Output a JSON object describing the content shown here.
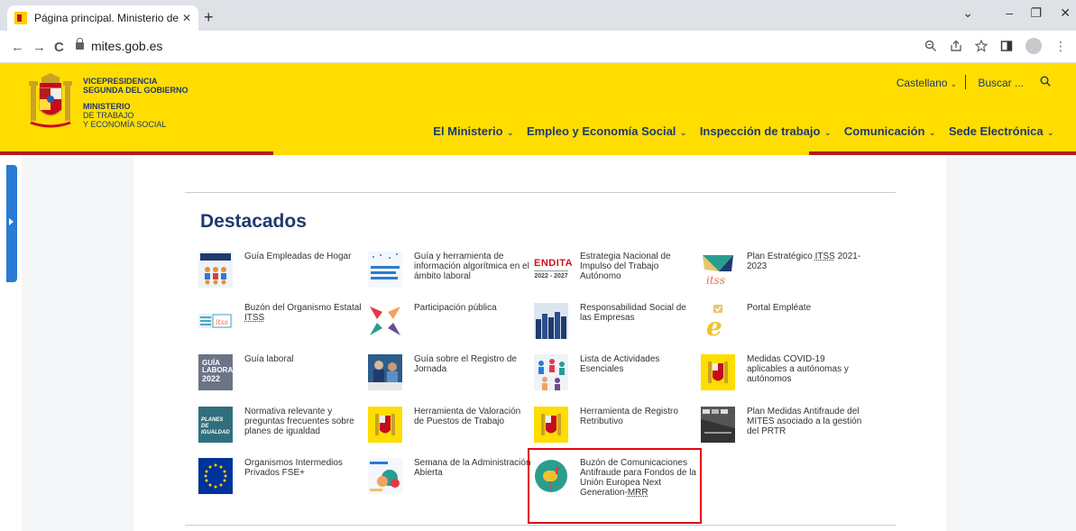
{
  "browser": {
    "tab_title": "Página principal. Ministerio de Tr",
    "tab_close": "✕",
    "new_tab": "+",
    "url": "mites.gob.es",
    "back": "←",
    "forward": "→",
    "reload": "C",
    "minimize": "–",
    "restore": "❐",
    "close": "✕",
    "chevron": "⌄"
  },
  "header": {
    "brand_line1": "VICEPRESIDENCIA",
    "brand_line2": "SEGUNDA DEL GOBIERNO",
    "brand_line3": "MINISTERIO",
    "brand_line4": "DE TRABAJO",
    "brand_line5": "Y ECONOMÍA SOCIAL",
    "language": "Castellano",
    "search": "Buscar ...",
    "nav": [
      {
        "label": "El Ministerio"
      },
      {
        "label": "Empleo y Economía Social"
      },
      {
        "label": "Inspección de trabajo"
      },
      {
        "label": "Comunicación"
      },
      {
        "label": "Sede Electrónica"
      }
    ]
  },
  "main": {
    "heading": "Destacados",
    "items": [
      {
        "label": "Guía Empleadas de Hogar"
      },
      {
        "label": "Guía y herramienta de información algorítmica en el ámbito laboral"
      },
      {
        "label": "Estrategia Nacional de Impulso del Trabajo Autónomo"
      },
      {
        "label_a": "Plan Estratégico ",
        "abbr": "ITSS",
        "label_b": " 2021-2023"
      },
      {
        "label_a": "Buzón del Organismo Estatal ",
        "abbr": "ITSS",
        "label_b": ""
      },
      {
        "label": "Participación pública"
      },
      {
        "label": "Responsabilidad Social de las Empresas"
      },
      {
        "label": "Portal Empléate"
      },
      {
        "label": "Guía laboral"
      },
      {
        "label": "Guía sobre el Registro de Jornada"
      },
      {
        "label": "Lista de Actividades Esenciales"
      },
      {
        "label": "Medidas COVID-19 aplicables a autónomas y autónomos"
      },
      {
        "label": "Normativa relevante y preguntas frecuentes sobre planes de igualdad"
      },
      {
        "label": "Herramienta de Valoración de Puestos de Trabajo"
      },
      {
        "label": "Herramienta de Registro Retributivo"
      },
      {
        "label": "Plan Medidas Antifraude del MITES asociado a la gestión del PRTR"
      },
      {
        "label": "Organismos Intermedios Privados FSE+"
      },
      {
        "label": "Semana de la Administración Abierta"
      },
      {
        "label_a": "Buzón de Comunicaciones Antifraude para Fondos de la Unión Europea Next Generation-",
        "abbr": "MRR",
        "label_b": ""
      }
    ],
    "icon_texts": {
      "endita_word": "ENDITA",
      "endita_years": "2022 - 2027",
      "guia_laboral_1": "GUÍA",
      "guia_laboral_2": "LABORAL",
      "guia_laboral_3": "2022",
      "planes_igualdad": "PLANES DE IGUALDAD"
    }
  },
  "colors": {
    "header_yellow": "#ffdd00",
    "navy": "#1f3a6d",
    "red_line": "#b31b1b",
    "highlight_red": "#e30613",
    "sidebar_blue": "#2a7bd3"
  }
}
